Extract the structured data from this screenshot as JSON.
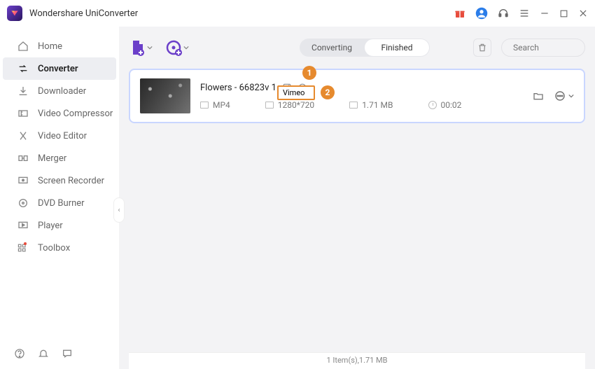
{
  "app": {
    "title": "Wondershare UniConverter"
  },
  "titlebar_icons": [
    "gift",
    "user",
    "headset",
    "menu",
    "minimize",
    "maximize",
    "close"
  ],
  "sidebar": {
    "items": [
      {
        "label": "Home",
        "icon": "home"
      },
      {
        "label": "Converter",
        "icon": "converter",
        "active": true
      },
      {
        "label": "Downloader",
        "icon": "download"
      },
      {
        "label": "Video Compressor",
        "icon": "compress"
      },
      {
        "label": "Video Editor",
        "icon": "editor"
      },
      {
        "label": "Merger",
        "icon": "merger"
      },
      {
        "label": "Screen Recorder",
        "icon": "recorder"
      },
      {
        "label": "DVD Burner",
        "icon": "dvd"
      },
      {
        "label": "Player",
        "icon": "player"
      },
      {
        "label": "Toolbox",
        "icon": "toolbox"
      }
    ]
  },
  "tabs": {
    "converting": "Converting",
    "finished": "Finished",
    "active": "converting"
  },
  "search": {
    "placeholder": "Search"
  },
  "item": {
    "title": "Flowers - 66823v 1",
    "format": "MP4",
    "resolution": "1280*720",
    "size": "1.71 MB",
    "duration": "00:02"
  },
  "callouts": {
    "one": "1",
    "two": "2",
    "two_label": "Vimeo"
  },
  "status": "1 Item(s),1.71 MB"
}
